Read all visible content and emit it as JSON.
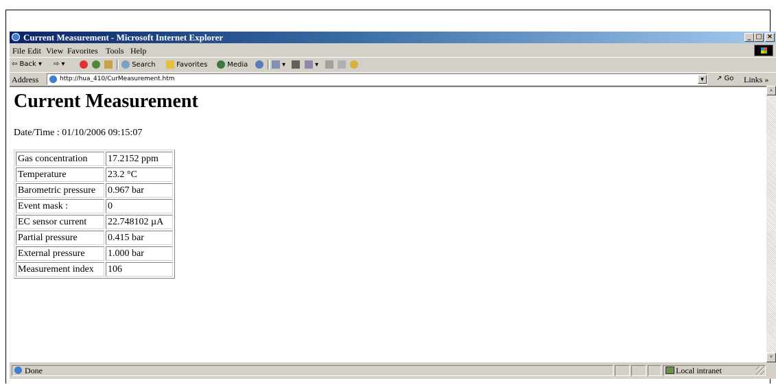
{
  "window": {
    "title": "Current Measurement - Microsoft Internet Explorer",
    "controls": [
      "_",
      "□",
      "×"
    ]
  },
  "menu": {
    "items": [
      "File",
      "Edit",
      "View",
      "Favorites",
      "Tools",
      "Help"
    ]
  },
  "toolbar": {
    "back": "⇦ Back ▾",
    "forward": "⇨ ▾",
    "search": "Search",
    "favorites": "Favorites",
    "media": "Media"
  },
  "address": {
    "label": "Address",
    "url": "http://hua_410/CurMeasurement.htm",
    "go": "Go",
    "links": "Links »"
  },
  "page": {
    "heading": "Current Measurement",
    "datetime": "Date/Time : 01/10/2006 09:15:07",
    "rows": [
      {
        "label": "Gas concentration",
        "value": "17.2152 ppm"
      },
      {
        "label": "Temperature",
        "value": "23.2 °C"
      },
      {
        "label": "Barometric pressure",
        "value": "0.967 bar"
      },
      {
        "label": "Event mask :",
        "value": "0"
      },
      {
        "label": "EC sensor current",
        "value": "22.748102 µA"
      },
      {
        "label": "Partial pressure",
        "value": "0.415 bar"
      },
      {
        "label": "External pressure",
        "value": "1.000 bar"
      },
      {
        "label": "Measurement index",
        "value": "106"
      }
    ]
  },
  "status": {
    "text": "Done",
    "zone": "Local intranet"
  },
  "colors": {
    "titlebar_start": "#0a246a",
    "titlebar_end": "#a6caf0",
    "chrome": "#d4d0c8"
  }
}
